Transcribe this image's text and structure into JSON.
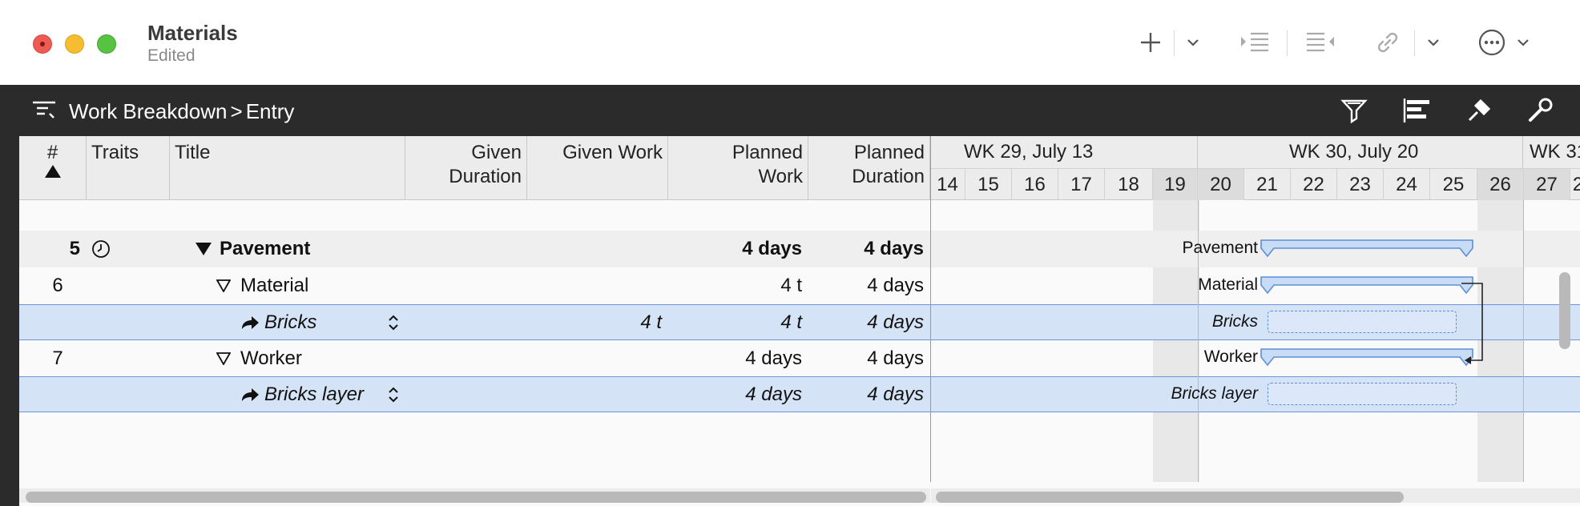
{
  "window": {
    "title": "Materials",
    "subtitle": "Edited"
  },
  "toolbar": {
    "icons": [
      "plus-icon",
      "chevron-down-icon",
      "indent-icon",
      "outdent-icon",
      "link-icon",
      "chevron-down-icon",
      "more-icon",
      "chevron-down-icon"
    ]
  },
  "breadcrumb": {
    "parent": "Work Breakdown",
    "separator": ">",
    "current": "Entry"
  },
  "columns": {
    "num": "#",
    "traits": "Traits",
    "title": "Title",
    "given_duration_1": "Given",
    "given_duration_2": "Duration",
    "given_work": "Given Work",
    "planned_work_1": "Planned",
    "planned_work_2": "Work",
    "planned_duration_1": "Planned",
    "planned_duration_2": "Duration"
  },
  "gantt": {
    "weeks": [
      "WK 29, July 13",
      "WK 30, July 20",
      "WK 31"
    ],
    "days": [
      "14",
      "15",
      "16",
      "17",
      "18",
      "19",
      "20",
      "21",
      "22",
      "23",
      "24",
      "25",
      "26",
      "27",
      "2"
    ]
  },
  "rows": [
    {
      "num": "5",
      "title": "Pavement",
      "given_duration": "",
      "given_work": "",
      "planned_work": "4 days",
      "planned_duration": "4 days",
      "bar_label": "Pavement"
    },
    {
      "num": "6",
      "title": "Material",
      "given_duration": "",
      "given_work": "",
      "planned_work": "4 t",
      "planned_duration": "4 days",
      "bar_label": "Material"
    },
    {
      "num": "",
      "title": "Bricks",
      "given_duration": "",
      "given_work": "4 t",
      "planned_work": "4 t",
      "planned_duration": "4 days",
      "bar_label": "Bricks"
    },
    {
      "num": "7",
      "title": "Worker",
      "given_duration": "",
      "given_work": "",
      "planned_work": "4 days",
      "planned_duration": "4 days",
      "bar_label": "Worker"
    },
    {
      "num": "",
      "title": "Bricks layer",
      "given_duration": "",
      "given_work": "",
      "planned_work": "4 days",
      "planned_duration": "4 days",
      "bar_label": "Bricks layer"
    }
  ],
  "colors": {
    "selection": "#d5e3f7",
    "bar": "#c9dcf6",
    "bar_border": "#5d8fd8",
    "dark_bar": "#2b2b2b"
  }
}
